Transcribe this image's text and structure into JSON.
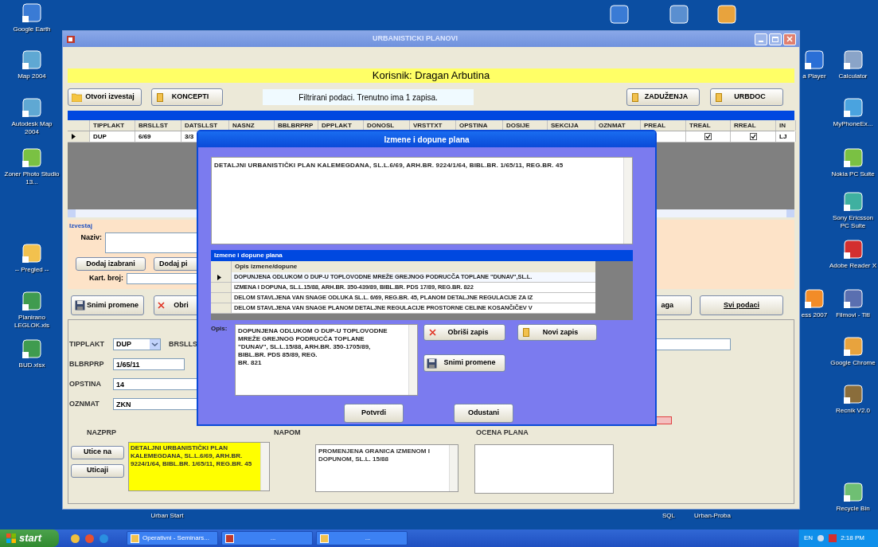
{
  "desktop": {
    "icons": [
      {
        "label": "Google Earth"
      },
      {
        "label": "Map 2004"
      },
      {
        "label": "Autodesk Map 2004"
      },
      {
        "label": "Zoner Photo Studio 13..."
      },
      {
        "label": "-- Pregled --"
      },
      {
        "label": "Planirano LEGLOK.xls"
      },
      {
        "label": "BUD.xlsx"
      },
      {
        "label": "a Player"
      },
      {
        "label": "Calculator"
      },
      {
        "label": "MyPhoneEx..."
      },
      {
        "label": "Nokia PC Suite"
      },
      {
        "label": "Sony Ericsson PC Suite"
      },
      {
        "label": "Adobe Reader X"
      },
      {
        "label": "ess 2007"
      },
      {
        "label": "Filmovi - Titl"
      },
      {
        "label": "Google Chrome"
      },
      {
        "label": "Recnik V2.0"
      },
      {
        "label": "Urban Start"
      },
      {
        "label": "SQL"
      },
      {
        "label": "Urban-Proba"
      },
      {
        "label": "Recycle Bin"
      }
    ]
  },
  "window": {
    "title": "URBANISTICKI PLANOVI",
    "user": "Korisnik: Dragan Arbutina",
    "toolbar_left": [
      {
        "label": "Otvori izvestaj"
      },
      {
        "label": "KONCEPTI"
      }
    ],
    "status": "Filtrirani podaci. Trenutno ima 1 zapisa.",
    "toolbar_right": [
      {
        "label": "ZADUŽENJA"
      },
      {
        "label": "URBDOC"
      }
    ],
    "grid": {
      "columns": [
        "TIPPLAKT",
        "BRSLLST",
        "DATSLLST",
        "NASNZ",
        "BBLBRPRP",
        "DPPLAKT",
        "DONOSL",
        "VRSTTXT",
        "OPSTINA",
        "DOSIJE",
        "SEKCIJA",
        "OZNMAT",
        "PREAL",
        "TREAL",
        "RREAL",
        "IN"
      ],
      "rows": [
        {
          "selected": true,
          "cells": [
            {
              "kind": "text",
              "value": "DUP"
            },
            {
              "kind": "text",
              "value": "6/69"
            },
            {
              "kind": "text",
              "value": "3/3"
            },
            {
              "kind": "covered"
            },
            {
              "kind": "covered"
            },
            {
              "kind": "covered"
            },
            {
              "kind": "covered"
            },
            {
              "kind": "covered"
            },
            {
              "kind": "covered"
            },
            {
              "kind": "covered"
            },
            {
              "kind": "covered"
            },
            {
              "kind": "covered"
            },
            {
              "kind": "empty"
            },
            {
              "kind": "check",
              "checked": true
            },
            {
              "kind": "check",
              "checked": true
            },
            {
              "kind": "text",
              "value": "LJ"
            }
          ]
        }
      ]
    },
    "report": {
      "title": "Izvestaj",
      "name_label": "Naziv:",
      "buttons": [
        "Dodaj izabrani",
        "Dodaj pi"
      ],
      "card_label": "Kart. broj:"
    },
    "actions_left": [
      {
        "label": "Snimi promene"
      },
      {
        "label": "Obri"
      }
    ],
    "actions_right": [
      {
        "label": "aga"
      },
      {
        "label": "Svi podaci"
      }
    ],
    "fields": [
      {
        "label": "TIPPLAKT",
        "value": "DUP",
        "kind": "select"
      },
      {
        "label": "BLBRPRP",
        "value": "1/65/11",
        "kind": "text"
      },
      {
        "label": "OPSTINA",
        "value": "14",
        "kind": "text"
      },
      {
        "label": "OZNMAT",
        "value": "ZKN",
        "kind": "text"
      }
    ],
    "brslls_label": "BRSLLS",
    "nazprp": {
      "label": "NAZPRP",
      "text": "DETALJNI URBANISTIČKI PLAN KALEMEGDANA, SL.L.6/69, ARH.BR. 9224/1/64, BIBL.BR. 1/65/11, REG.BR. 45",
      "buttons": [
        "Utice na",
        "Uticaji"
      ]
    },
    "napom": {
      "label": "NAPOM",
      "text": "PROMENJENA GRANICA IZMENOM I DOPUNOM, SL.L. 15/88"
    },
    "ocena": {
      "label": "OCENA PLANA"
    }
  },
  "dialog": {
    "title": "Izmene i dopune plana",
    "plan_text": "DETALJNI URBANISTIČKI PLAN KALEMEGDANA, SL.L.6/69, ARH.BR. 9224/1/64, BIBL.BR. 1/65/11, REG.BR. 45",
    "grid": {
      "caption": "Izmene i dopune plana",
      "column": "Opis izmene/dopune",
      "rows": [
        {
          "text": "DOPUNJENA ODLUKOM O DUP-U TOPLOVODNE MREŽE GREJNOG PODRUCČA TOPLANE \"DUNAV\",SL.L.",
          "selected": true
        },
        {
          "text": "IZMENA I DOPUNA, SL.L.15/88, ARH.BR. 350-439/89, BIBL.BR. PDS 17/89, REG.BR. 822",
          "selected": false
        },
        {
          "text": "DELOM STAVLJENA VAN SNAGE ODLUKA SL.L. 6/69, REG.BR. 45, PLANOM DETALJNE REGULACIJE ZA IZ",
          "selected": false
        },
        {
          "text": "DELOM STAVLJENA VAN SNAGE PLANOM DETALJNE REGULACIJE PROSTORNE CELINE KOSANČIČEV V",
          "selected": false
        }
      ]
    },
    "opis_label": "Opis:",
    "opis_text": "DOPUNJENA ODLUKOM O DUP-U TOPLOVODNE\nMREŽE GREJNOG PODRUCČA TOPLANE\n\"DUNAV\", SL.L.15/88, ARH.BR. 350-1705/89,\nBIBL.BR. PDS 85/89, REG.\nBR. 821",
    "delete_button": {
      "label": "Obriši zapis"
    },
    "new_button": {
      "label": "Novi zapis"
    },
    "save_button": {
      "label": "Snimi promene"
    },
    "ok": "Potvrdi",
    "cancel": "Odustani"
  },
  "taskbar": {
    "start": "start",
    "tasks": [
      {
        "label": "Operativni - Seminars..."
      },
      {
        "label": "..."
      },
      {
        "label": "..."
      }
    ],
    "language": "EN",
    "clock": "2:18 PM"
  }
}
